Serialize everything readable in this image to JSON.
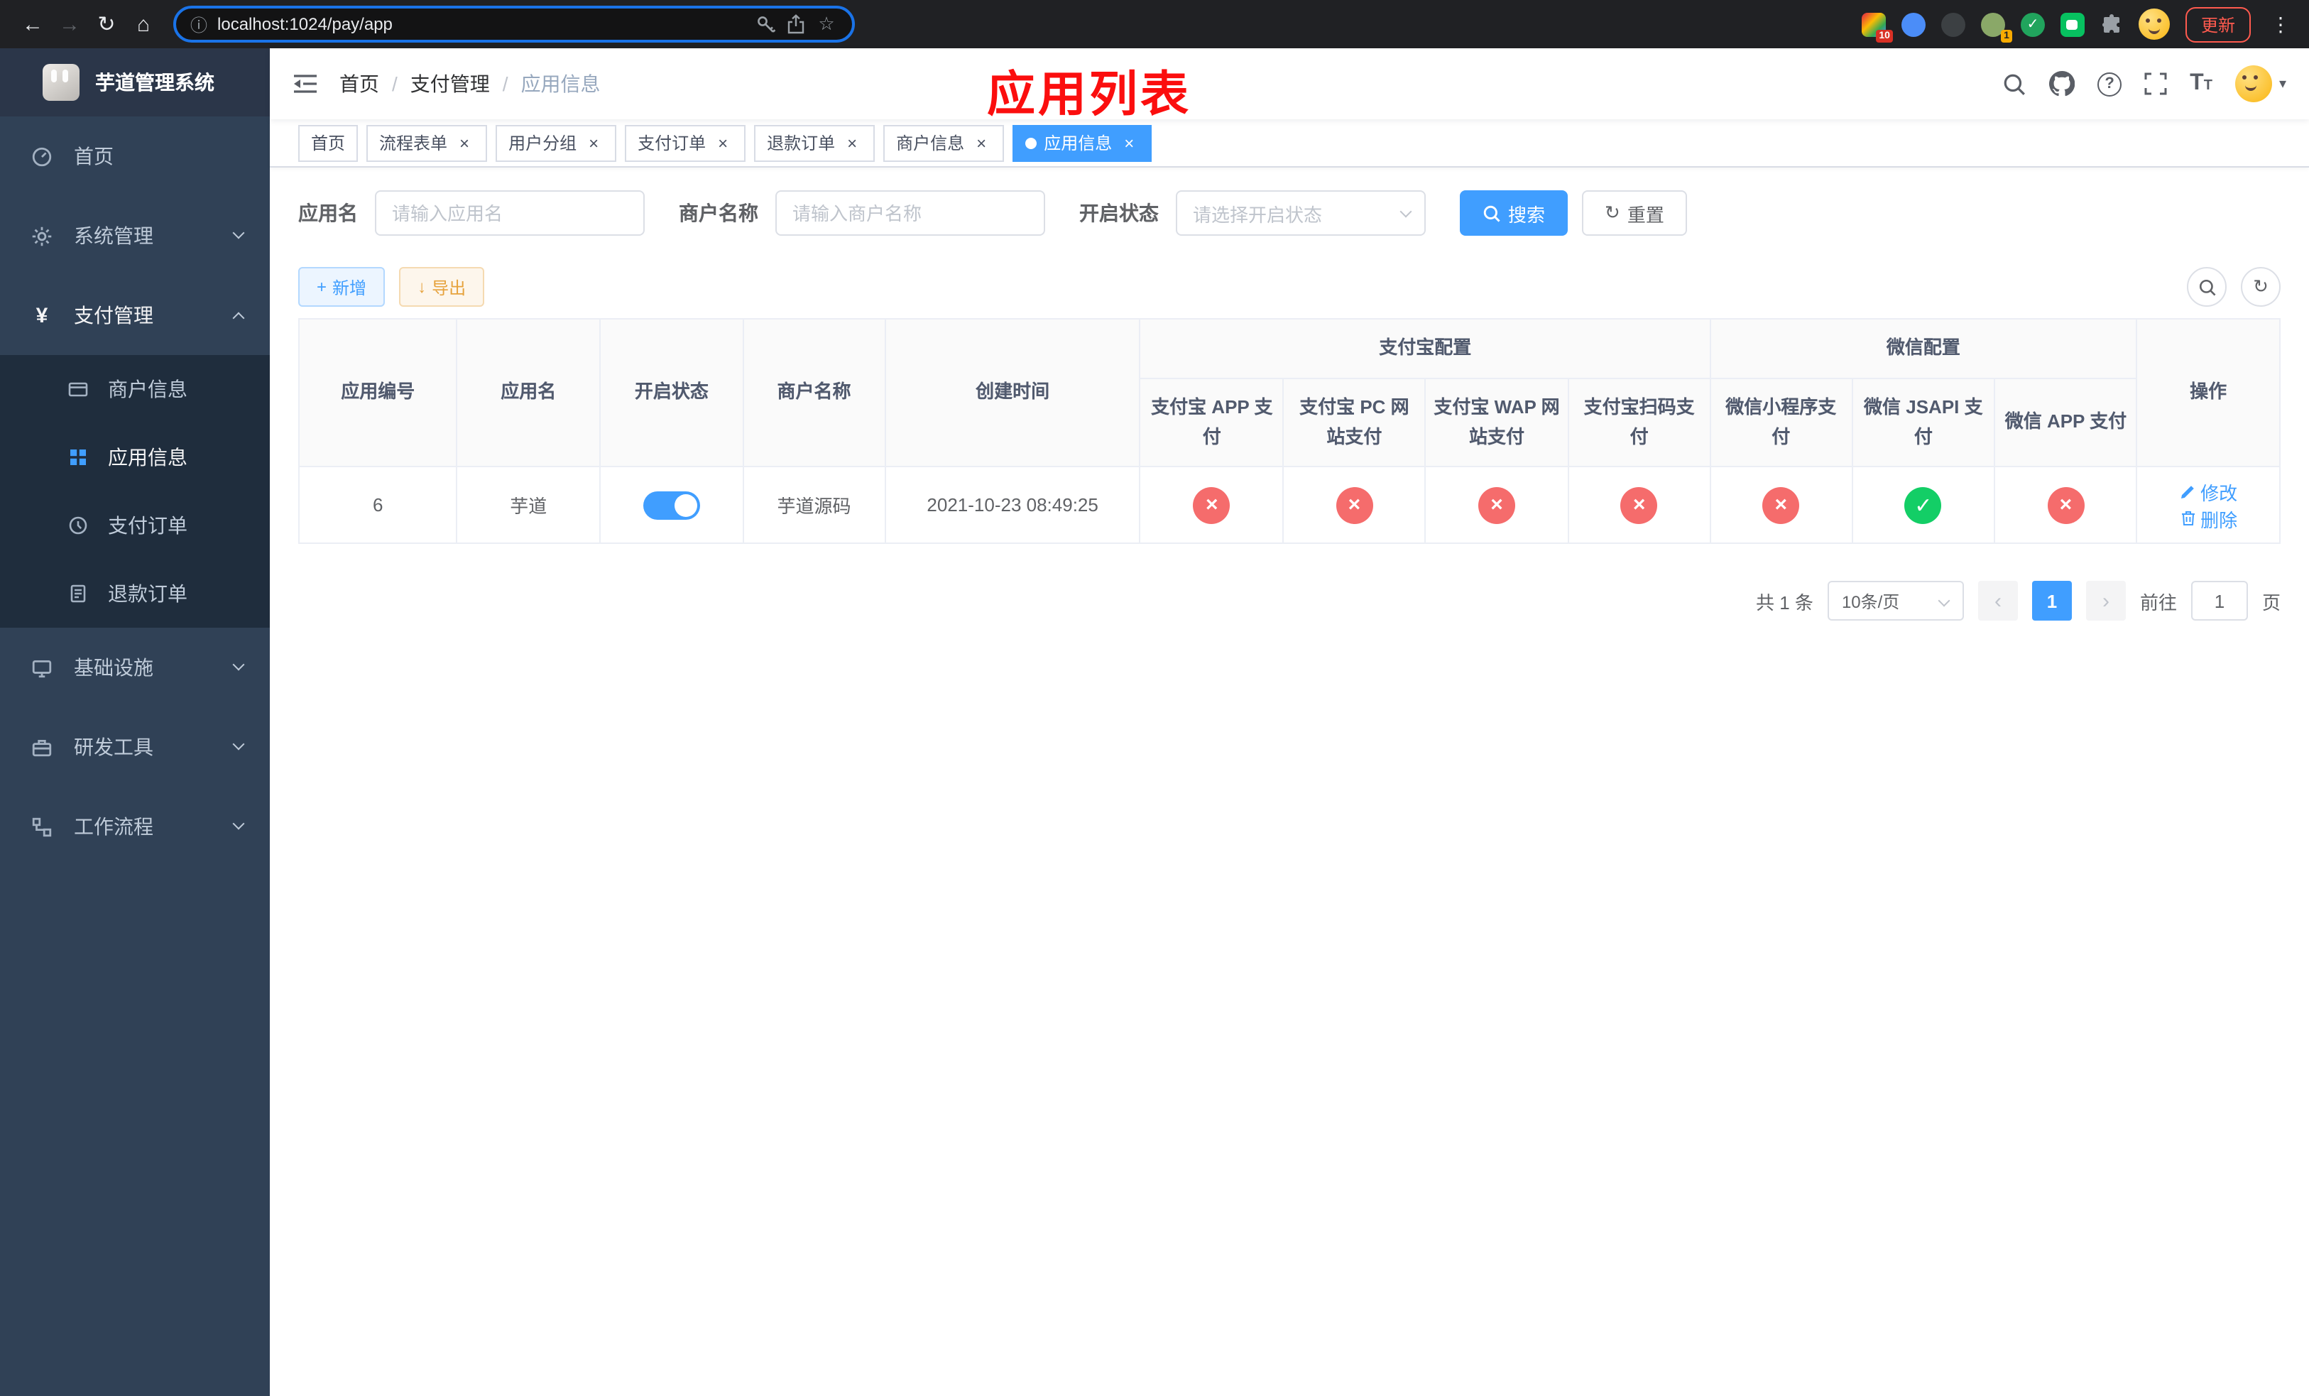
{
  "colors": {
    "primary": "#409eff",
    "success": "#13ce66",
    "danger": "#f56c6c",
    "warning": "#e6a23c",
    "sidebar_bg": "#304156",
    "submenu_bg": "#1f2d3d",
    "annotation_red": "#fb0e0e"
  },
  "icons": {
    "back": "←",
    "forward": "→",
    "reload": "↻",
    "home": "⌂",
    "info": "ⓘ",
    "star": "☆",
    "more": "⋮",
    "yen": "¥",
    "plus": "+",
    "download": "↓",
    "reset": "↻",
    "close": "×",
    "check": "✓",
    "cross": "×",
    "question": "?",
    "caret": "▾",
    "prev": "‹",
    "next": "›",
    "text_size": "T"
  },
  "browser": {
    "url": "localhost:1024/pay/app",
    "update_button": "更新",
    "ext_badge_blocker": "10",
    "ext_badge_avatar": "1"
  },
  "sidebar": {
    "app_title": "芋道管理系统",
    "menu": {
      "home": "首页",
      "system": "系统管理",
      "payment": "支付管理",
      "infra": "基础设施",
      "devtools": "研发工具",
      "workflow": "工作流程",
      "payment_children": [
        "商户信息",
        "应用信息",
        "支付订单",
        "退款订单"
      ]
    }
  },
  "header": {
    "breadcrumb": [
      "首页",
      "支付管理",
      "应用信息"
    ],
    "separator": "/",
    "annotation": "应用列表"
  },
  "tabs": [
    {
      "label": "首页"
    },
    {
      "label": "流程表单"
    },
    {
      "label": "用户分组"
    },
    {
      "label": "支付订单"
    },
    {
      "label": "退款订单"
    },
    {
      "label": "商户信息"
    },
    {
      "label": "应用信息"
    }
  ],
  "filters": {
    "app_name_label": "应用名",
    "app_name_placeholder": "请输入应用名",
    "merchant_label": "商户名称",
    "merchant_placeholder": "请输入商户名称",
    "status_label": "开启状态",
    "status_placeholder": "请选择开启状态",
    "search_button": "搜索",
    "reset_button": "重置"
  },
  "toolbar": {
    "add_button": "新增",
    "export_button": "导出"
  },
  "table": {
    "group_alipay": "支付宝配置",
    "group_wechat": "微信配置",
    "columns": {
      "id": "应用编号",
      "name": "应用名",
      "status": "开启状态",
      "merchant": "商户名称",
      "created": "创建时间",
      "alipay_app": "支付宝 APP 支付",
      "alipay_pc": "支付宝 PC 网站支付",
      "alipay_wap": "支付宝 WAP 网站支付",
      "alipay_qr": "支付宝扫码支付",
      "wx_lite": "微信小程序支付",
      "wx_jsapi": "微信 JSAPI 支付",
      "wx_app": "微信 APP 支付",
      "actions": "操作"
    },
    "rows": [
      {
        "id": "6",
        "name": "芋道",
        "enabled": true,
        "merchant": "芋道源码",
        "created": "2021-10-23 08:49:25",
        "channels": {
          "alipay_app": false,
          "alipay_pc": false,
          "alipay_wap": false,
          "alipay_qr": false,
          "wx_lite": false,
          "wx_jsapi": true,
          "wx_app": false
        },
        "edit_label": "修改",
        "delete_label": "删除"
      }
    ]
  },
  "pagination": {
    "total": "共 1 条",
    "page_size": "10条/页",
    "current_page": "1",
    "goto_label": "前往",
    "goto_value": "1",
    "page_unit": "页"
  }
}
